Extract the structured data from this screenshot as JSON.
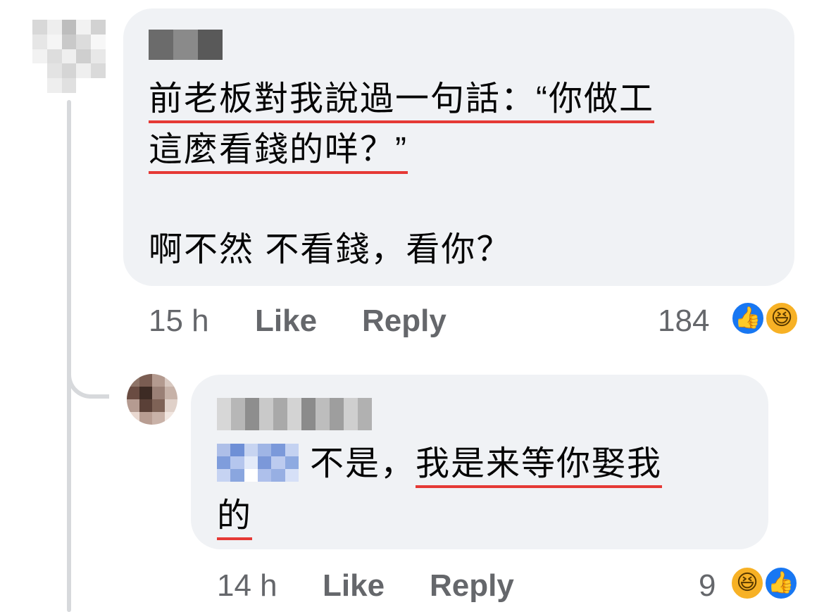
{
  "comments": [
    {
      "author": "",
      "body": {
        "line1": "前老板對我說過一句話：“你做工",
        "line2": "這麼看錢的咩？”",
        "line3": "啊不然 不看錢，看你？"
      },
      "time": "15 h",
      "like_label": "Like",
      "reply_label": "Reply",
      "reaction_count": "184",
      "reactions": [
        "like-icon",
        "haha-icon"
      ]
    }
  ],
  "reply": {
    "author": "",
    "mention": "",
    "body": {
      "line1_prefix": "不是，",
      "line1_underlined": "我是来等你娶我",
      "line2": "的"
    },
    "time": "14 h",
    "like_label": "Like",
    "reply_label": "Reply",
    "reaction_count": "9",
    "reactions": [
      "haha-icon",
      "like-icon"
    ]
  },
  "colors": {
    "bubble": "#f0f2f5",
    "meta_text": "#65676b",
    "underline": "#e53935",
    "like_blue": "#1877f2",
    "haha_yellow": "#f7b125"
  }
}
